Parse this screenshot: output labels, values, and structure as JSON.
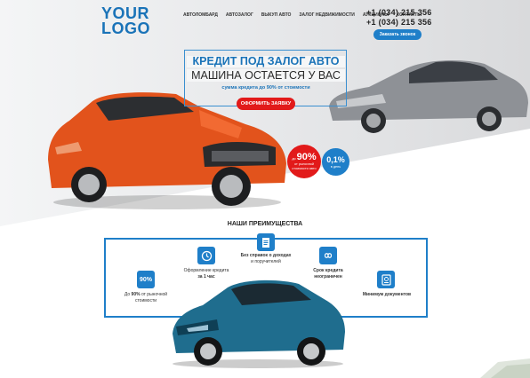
{
  "header": {
    "logo_line1": "YOUR",
    "logo_line2": "LOGO",
    "nav": [
      "АВТОЛОМБАРД",
      "АВТОЗАЛОГ",
      "ВЫКУП АВТО",
      "ЗАЛОГ НЕДВИЖИМОСТИ",
      "АУКЦИОНЫ",
      "КОНТАКТЫ"
    ],
    "phone1": "+1 (034) 215 356",
    "phone2": "+1 (034) 215 356",
    "callback_label": "Заказать звонок"
  },
  "hero": {
    "title_line1": "КРЕДИТ ПОД ЗАЛОГ АВТО",
    "title_line2": "МАШИНА ОСТАЕТСЯ У ВАС",
    "subtitle": "сумма кредита до 90% от стоимости",
    "apply_label": "ОФОРМИТЬ ЗАЯВКУ",
    "badge_red": {
      "prefix": "до",
      "value": "90%",
      "caption": "от рыночной стоимости авто"
    },
    "badge_blue": {
      "value": "0,1%",
      "caption": "в день"
    }
  },
  "advantages": {
    "title": "НАШИ ПРЕИМУЩЕСТВА",
    "items": [
      {
        "line1": "Без справок о доходах",
        "line2": "и поручителей"
      },
      {
        "line1": "Оформление кредита",
        "line2": "за 1 час"
      },
      {
        "line1": "Срок кредита",
        "line2": "неограничен"
      },
      {
        "icon_label": "90%",
        "line1_pre": "До ",
        "line1_bold": "90%",
        "line1_post": " от рыночной",
        "line2": "стоимости"
      },
      {
        "line1": "Минимум документов"
      }
    ]
  },
  "colors": {
    "accent": "#1f7fc9",
    "cta": "#e21a1a"
  },
  "icons": [
    "document-icon",
    "clock-icon",
    "infinity-icon",
    "passport-icon"
  ]
}
